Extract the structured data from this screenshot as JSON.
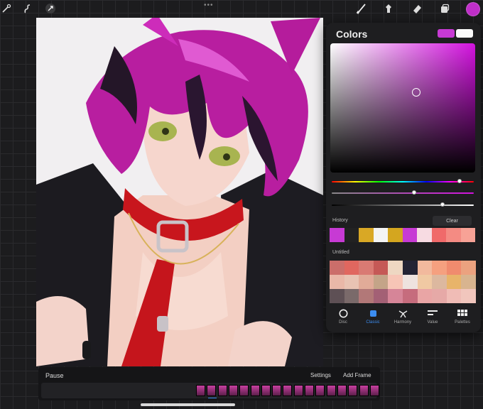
{
  "toolbar": {
    "left_icons": [
      "wrench-icon",
      "adjustments-icon",
      "selection-icon",
      "transform-icon"
    ],
    "right_icons": [
      "brush-icon",
      "smudge-icon",
      "eraser-icon",
      "layers-icon"
    ],
    "current_color": "#c02fc9"
  },
  "colors_panel": {
    "title": "Colors",
    "current_swatch": "#c73ad4",
    "previous_swatch": "#fafafa",
    "history_label": "History",
    "clear_label": "Clear",
    "history": [
      "#c73ad4",
      "#222222",
      "#d9a825",
      "#f4f4f4",
      "#d4a61f",
      "#c73ad4",
      "#f7dbe2",
      "#f06a6a",
      "#f48b83",
      "#f7a296"
    ],
    "palette_name": "Untitled",
    "palette": [
      "#cb6e6a",
      "#e0675f",
      "#d97a73",
      "#c55956",
      "#eed7c2",
      "#232334",
      "#f2b99d",
      "#f5a07f",
      "#f08b6e",
      "#eba27f",
      "#e9b8a8",
      "#e8c3b3",
      "#e1ab98",
      "#c4a488",
      "#f7c5b6",
      "#eee3df",
      "#f0c9a3",
      "#dcb89f",
      "#e8b46a",
      "#d8b48f",
      "#5e5055",
      "#7a6a6a",
      "#b27878",
      "#a36075",
      "#d68598",
      "#c66c7d",
      "#e9a5a5",
      "#e6a9a7",
      "#f0bcb6",
      "#f1c6bd"
    ],
    "modes": [
      {
        "label": "Disc",
        "icon": "disc-icon"
      },
      {
        "label": "Classic",
        "icon": "classic-icon"
      },
      {
        "label": "Harmony",
        "icon": "harmony-icon"
      },
      {
        "label": "Value",
        "icon": "value-icon"
      },
      {
        "label": "Palettes",
        "icon": "palettes-icon"
      }
    ],
    "active_mode": "Classic",
    "hue_level": 0.9,
    "saturation_level": 0.58,
    "brightness_level": 0.78
  },
  "animation": {
    "pause_label": "Pause",
    "settings_label": "Settings",
    "add_frame_label": "Add Frame",
    "frame_count": 17
  }
}
